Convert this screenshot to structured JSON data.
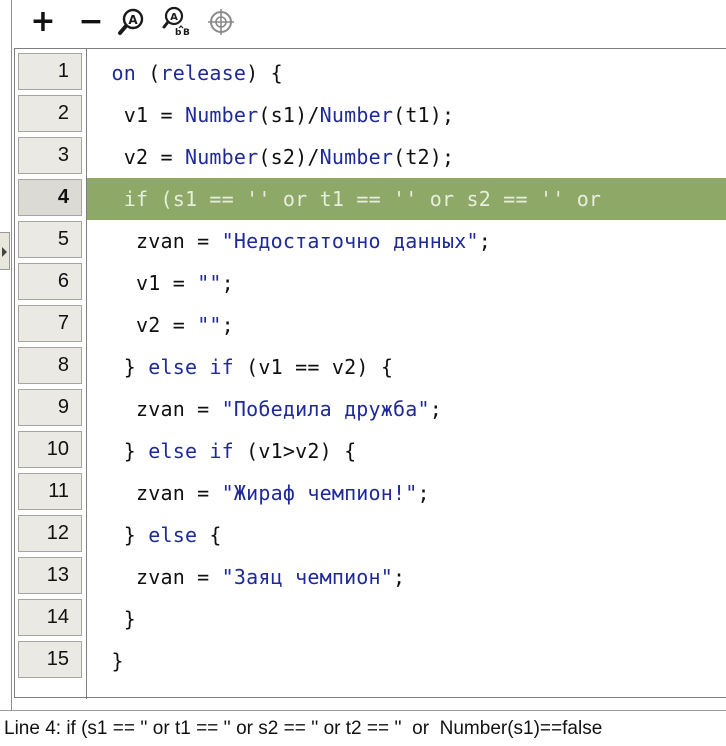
{
  "toolbar": {
    "add_label": "+",
    "remove_label": "−",
    "icons": [
      "find-icon",
      "replace-icon",
      "target-icon"
    ]
  },
  "editor": {
    "active_line": 4,
    "highlight_color": "#8ea868",
    "lines": [
      {
        "number": "1",
        "indent": "",
        "code": "on (release) {"
      },
      {
        "number": "2",
        "indent": " ",
        "code": "v1 = Number(s1)/Number(t1);"
      },
      {
        "number": "3",
        "indent": " ",
        "code": "v2 = Number(s2)/Number(t2);"
      },
      {
        "number": "4",
        "indent": " ",
        "code": "if (s1 == '' or t1 == '' or s2 == '' or"
      },
      {
        "number": "5",
        "indent": "  ",
        "code": "zvan = \"Недостаточно данных\";"
      },
      {
        "number": "6",
        "indent": "  ",
        "code": "v1 = \"\";"
      },
      {
        "number": "7",
        "indent": "  ",
        "code": "v2 = \"\";"
      },
      {
        "number": "8",
        "indent": " ",
        "code": "} else if (v1 == v2) {"
      },
      {
        "number": "9",
        "indent": "  ",
        "code": "zvan = \"Победила дружба\";"
      },
      {
        "number": "10",
        "indent": " ",
        "code": "} else if (v1>v2) {"
      },
      {
        "number": "11",
        "indent": "  ",
        "code": "zvan = \"Жираф чемпион!\";"
      },
      {
        "number": "12",
        "indent": " ",
        "code": "} else {"
      },
      {
        "number": "13",
        "indent": "  ",
        "code": "zvan = \"Заяц чемпион\";"
      },
      {
        "number": "14",
        "indent": " ",
        "code": "}"
      },
      {
        "number": "15",
        "indent": "",
        "code": "}"
      }
    ]
  },
  "status": {
    "text": "Line 4: if (s1 == '' or t1 == '' or s2 == '' or t2 == ''  or  Number(s1)==false"
  }
}
